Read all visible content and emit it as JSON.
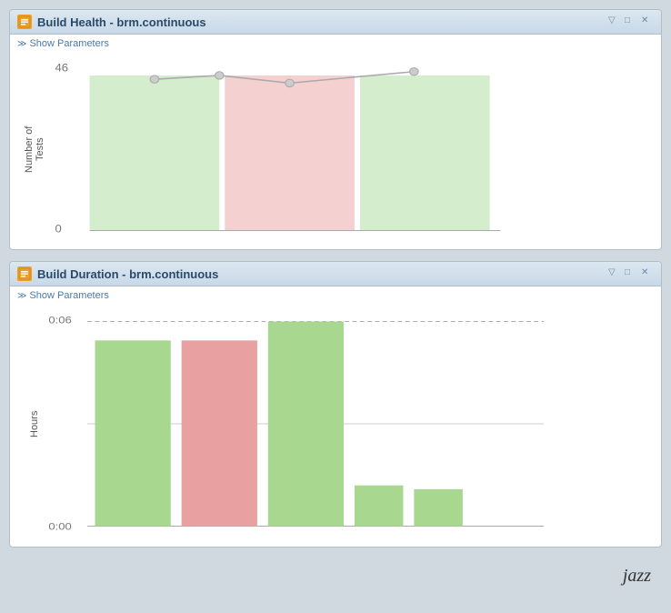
{
  "panel1": {
    "title": "Build Health - brm.continuous",
    "show_parameters_label": "Show Parameters",
    "y_axis_label": "Number of\nTests",
    "y_max": "46",
    "y_min": "0",
    "chart": {
      "bars": [
        {
          "color": "#c8e8c0",
          "height_pct": 90
        },
        {
          "color": "#f0c0c0",
          "height_pct": 90
        },
        {
          "color": "#c8e8c0",
          "height_pct": 90
        }
      ],
      "line_points": [
        {
          "x_pct": 20,
          "y_pct": 20
        },
        {
          "x_pct": 42,
          "y_pct": 18
        },
        {
          "x_pct": 63,
          "y_pct": 22
        },
        {
          "x_pct": 78,
          "y_pct": 15
        }
      ]
    }
  },
  "panel2": {
    "title": "Build Duration - brm.continuous",
    "show_parameters_label": "Show Parameters",
    "y_axis_label": "Hours",
    "y_max": "0:06",
    "y_min": "0:00",
    "chart": {
      "bars": [
        {
          "color": "#a8d890",
          "height_pct": 82,
          "label": ""
        },
        {
          "color": "#e8a0a0",
          "height_pct": 82,
          "label": ""
        },
        {
          "color": "#a8d890",
          "height_pct": 98,
          "label": ""
        },
        {
          "color": "#a8d890",
          "height_pct": 18,
          "label": ""
        },
        {
          "color": "#a8d890",
          "height_pct": 16,
          "label": ""
        }
      ]
    }
  },
  "footer": {
    "logo": "jazz"
  },
  "icons": {
    "minimize": "▽",
    "maximize": "□",
    "close": "✕",
    "build": "B"
  }
}
